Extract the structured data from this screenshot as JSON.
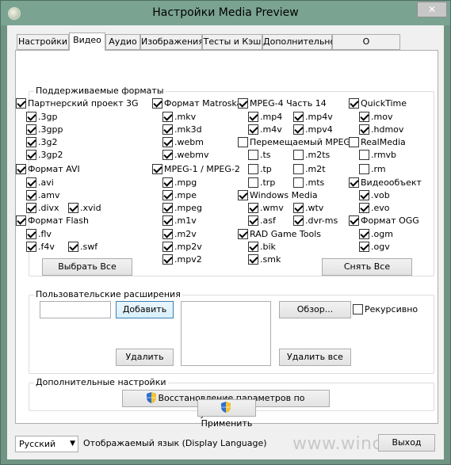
{
  "window": {
    "title": "Настройки Media Preview",
    "close_glyph": "✕"
  },
  "tabs": [
    "Настройки",
    "Видео",
    "Аудио",
    "Изображения",
    "Тесты и Кэш",
    "Дополнительно",
    "О программе..."
  ],
  "formats": {
    "title": "Поддерживаемые форматы",
    "items": [
      {
        "label": "Партнерский проект 3G",
        "checked": true
      },
      {
        "label": ".3gp",
        "checked": true
      },
      {
        "label": ".3gpp",
        "checked": true
      },
      {
        "label": ".3g2",
        "checked": true
      },
      {
        "label": ".3gp2",
        "checked": true
      },
      {
        "label": "Формат AVI",
        "checked": true
      },
      {
        "label": ".avi",
        "checked": true
      },
      {
        "label": ".amv",
        "checked": true
      },
      {
        "label": ".divx",
        "checked": true
      },
      {
        "label": ".xvid",
        "checked": true
      },
      {
        "label": "Формат Flash",
        "checked": true
      },
      {
        "label": ".flv",
        "checked": true
      },
      {
        "label": ".f4v",
        "checked": true
      },
      {
        "label": ".swf",
        "checked": true
      },
      {
        "label": "Формат Matroska",
        "checked": true
      },
      {
        "label": ".mkv",
        "checked": true
      },
      {
        "label": ".mk3d",
        "checked": true
      },
      {
        "label": ".webm",
        "checked": true
      },
      {
        "label": ".webmv",
        "checked": true
      },
      {
        "label": "MPEG-1 / MPEG-2",
        "checked": true
      },
      {
        "label": ".mpg",
        "checked": true
      },
      {
        "label": ".mpe",
        "checked": true
      },
      {
        "label": ".mpeg",
        "checked": true
      },
      {
        "label": ".m1v",
        "checked": true
      },
      {
        "label": ".m2v",
        "checked": true
      },
      {
        "label": ".mp2v",
        "checked": true
      },
      {
        "label": ".mpv2",
        "checked": true
      },
      {
        "label": "MPEG-4 Часть 14",
        "checked": true
      },
      {
        "label": ".mp4",
        "checked": true
      },
      {
        "label": ".mp4v",
        "checked": true
      },
      {
        "label": ".m4v",
        "checked": true
      },
      {
        "label": ".mpv4",
        "checked": true
      },
      {
        "label": "Перемещаемый MPEG",
        "checked": false
      },
      {
        "label": ".ts",
        "checked": false
      },
      {
        "label": ".m2ts",
        "checked": false
      },
      {
        "label": ".tp",
        "checked": false
      },
      {
        "label": ".m2t",
        "checked": false
      },
      {
        "label": ".trp",
        "checked": false
      },
      {
        "label": ".mts",
        "checked": false
      },
      {
        "label": "Windows Media",
        "checked": true
      },
      {
        "label": ".wmv",
        "checked": true
      },
      {
        "label": ".wtv",
        "checked": true
      },
      {
        "label": ".asf",
        "checked": true
      },
      {
        "label": ".dvr-ms",
        "checked": true
      },
      {
        "label": "RAD Game Tools",
        "checked": true
      },
      {
        "label": ".bik",
        "checked": true
      },
      {
        "label": ".smk",
        "checked": true
      },
      {
        "label": "QuickTime",
        "checked": true
      },
      {
        "label": ".mov",
        "checked": true
      },
      {
        "label": ".hdmov",
        "checked": true
      },
      {
        "label": "RealMedia",
        "checked": false
      },
      {
        "label": ".rmvb",
        "checked": false
      },
      {
        "label": ".rm",
        "checked": false
      },
      {
        "label": "Видеообъект",
        "checked": true
      },
      {
        "label": ".vob",
        "checked": true
      },
      {
        "label": ".evo",
        "checked": true
      },
      {
        "label": "Формат OGG",
        "checked": true
      },
      {
        "label": ".ogm",
        "checked": true
      },
      {
        "label": ".ogv",
        "checked": true
      }
    ],
    "select_all": "Выбрать Все",
    "deselect_all": "Снять Все"
  },
  "custom": {
    "title": "Пользовательские расширения",
    "input_value": "",
    "add": "Добавить",
    "browse": "Обзор...",
    "recursive": "Рекурсивно",
    "recursive_checked": false,
    "remove": "Удалить",
    "remove_all": "Удалить все"
  },
  "extra": {
    "title": "Дополнительные настройки",
    "restore": "Восстановление параметров по умолчанию"
  },
  "apply": "Применить",
  "footer": {
    "language": "Русский",
    "language_label": "Отображаемый язык (Display Language)",
    "exit": "Выход",
    "watermark": "www.wincore.ru"
  },
  "colors": {
    "frame": "#6f9484",
    "shield_blue": "#2f6fd0",
    "shield_yellow": "#f2c230"
  }
}
